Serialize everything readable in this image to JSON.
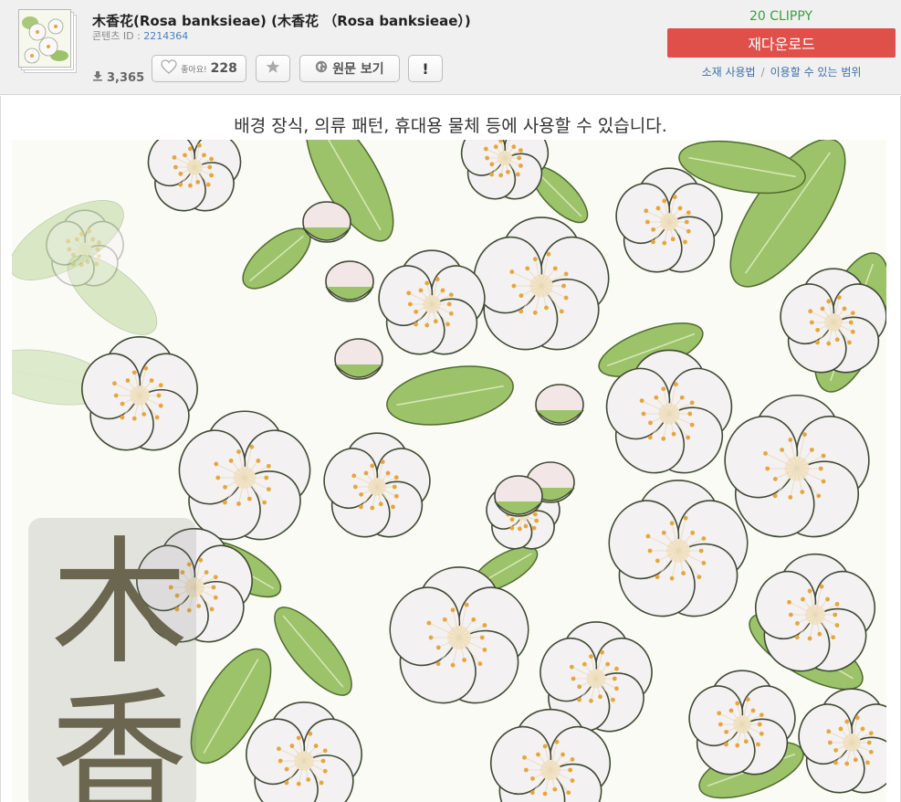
{
  "header": {
    "title": "木香花(Rosa banksieae) (木香花 （Rosa banksieae）)",
    "content_id_label": "콘텐츠 ID :",
    "content_id": "2214364",
    "downloads": "3,365",
    "like_label": "좋아요!",
    "like_count": "228",
    "source_label": "원문 보기",
    "report_label": "!",
    "clippy": "20 CLIPPY",
    "redownload_label": "재다운로드",
    "usage_link": "소재 사용법",
    "license_link": "이용할 수 있는 범위",
    "link_separator": "/"
  },
  "main": {
    "description": "배경 장식, 의류 패턴, 휴대용 물체 등에 사용할 수 있습니다.",
    "kanji_1": "木",
    "kanji_2": "香"
  },
  "colors": {
    "accent_red": "#e0504a",
    "clippy_green": "#3aa13a",
    "link_blue": "#3d6fa8",
    "petal": "#f4f1f3",
    "leaf": "#9cc36a",
    "stamen": "#e6a63c"
  },
  "icons": {
    "download": "download-icon",
    "heart": "heart-icon",
    "star": "star-icon",
    "globe": "globe-icon"
  }
}
